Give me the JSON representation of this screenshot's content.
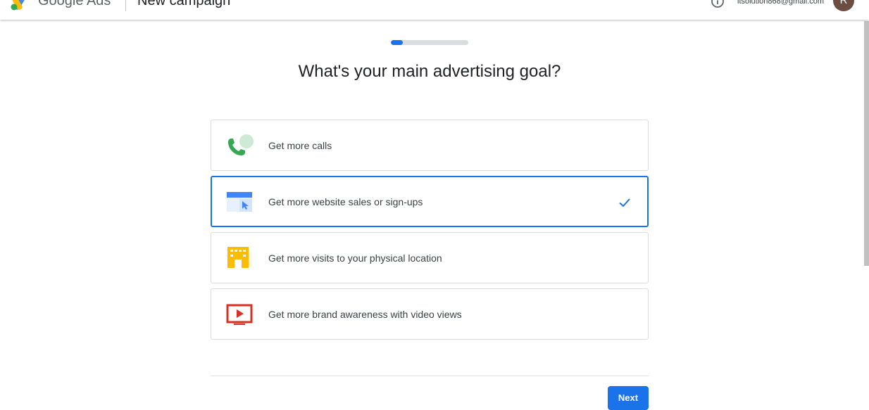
{
  "header": {
    "brand": "Google Ads",
    "page_name": "New campaign",
    "account_email": "itsolution868@gmail.com",
    "avatar_initial": "R",
    "help_icon": "help-circle-icon"
  },
  "progress": {
    "fraction": 0.15,
    "color": "#1a73e8",
    "track_color": "#dadce0"
  },
  "main": {
    "heading": "What's your main advertising goal?",
    "goals": [
      {
        "label": "Get more calls",
        "icon": "phone-call-icon",
        "selected": false
      },
      {
        "label": "Get more website sales or sign-ups",
        "icon": "website-click-icon",
        "selected": true
      },
      {
        "label": "Get more visits to your physical location",
        "icon": "storefront-icon",
        "selected": false
      },
      {
        "label": "Get more brand awareness with video views",
        "icon": "video-play-icon",
        "selected": false
      }
    ]
  },
  "footer": {
    "next_label": "Next"
  },
  "colors": {
    "accent": "#1a73e8",
    "card_border": "#dadce0",
    "avatar_bg": "#6d4c41"
  }
}
